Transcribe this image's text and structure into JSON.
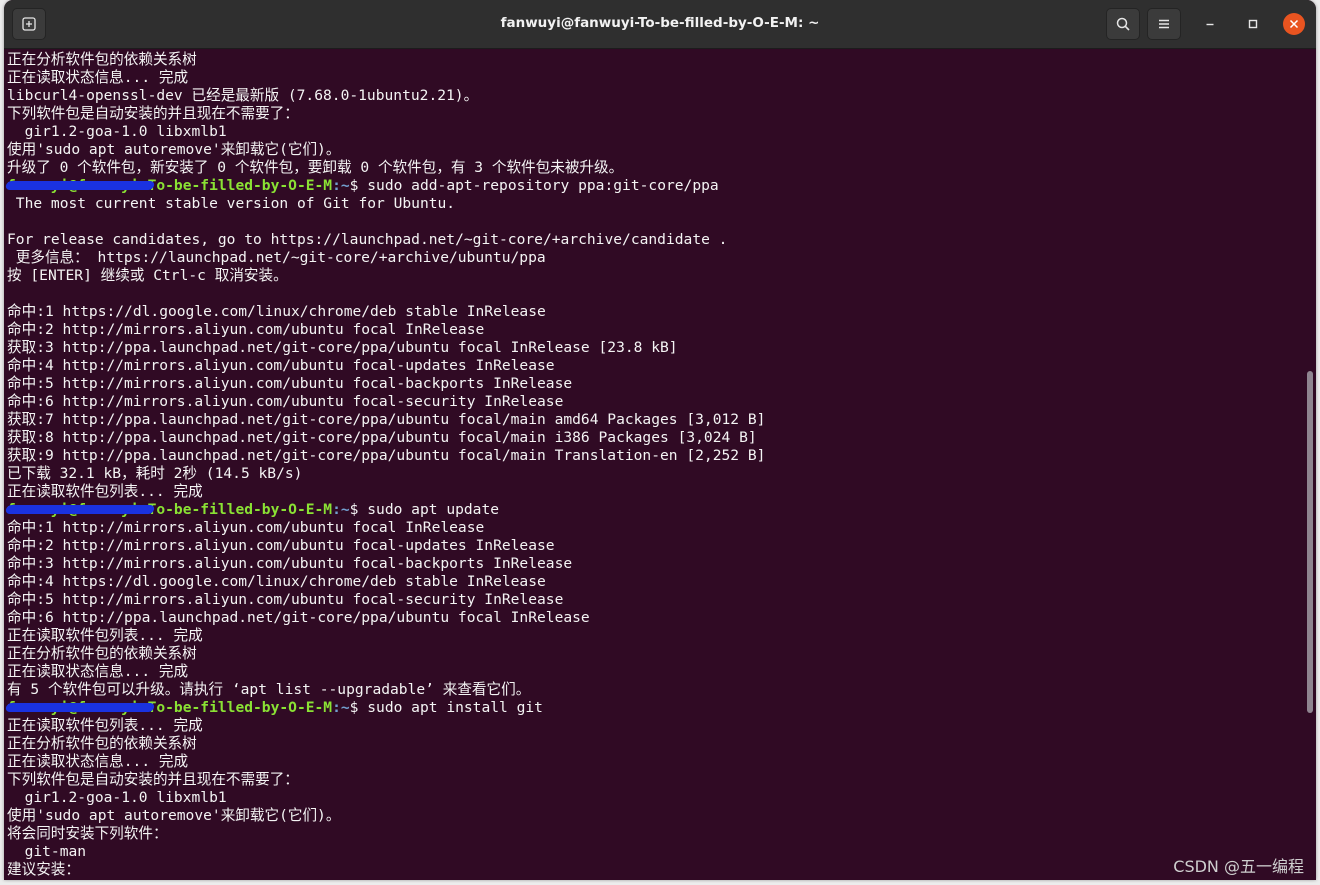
{
  "window": {
    "title": "fanwuyi@fanwuyi-To-be-filled-by-O-E-M: ~"
  },
  "icons": {
    "new_tab": "new-tab-icon",
    "search": "search-icon",
    "menu": "hamburger-menu-icon",
    "minimize": "minimize-icon",
    "maximize": "maximize-icon",
    "close": "close-icon"
  },
  "colors": {
    "terminal_bg": "#300a24",
    "prompt_user": "#8ae234",
    "prompt_path": "#729fcf",
    "close_button": "#e95420"
  },
  "terminal": {
    "lines": [
      {
        "text": "正在分析软件包的依赖关系树"
      },
      {
        "text": "正在读取状态信息... 完成"
      },
      {
        "text": "libcurl4-openssl-dev 已经是最新版 (7.68.0-1ubuntu2.21)。"
      },
      {
        "text": "下列软件包是自动安装的并且现在不需要了："
      },
      {
        "text": "  gir1.2-goa-1.0 libxmlb1"
      },
      {
        "text": "使用'sudo apt autoremove'来卸载它(它们)。"
      },
      {
        "text": "升级了 0 个软件包，新安装了 0 个软件包，要卸载 0 个软件包，有 3 个软件包未被升级。"
      },
      {
        "prompt_user": "fanwuyi@fanwuyi-To-be-filled-by-O-E-M",
        "prompt_path": ":~",
        "command": "$ sudo add-apt-repository ppa:git-core/ppa"
      },
      {
        "text": " The most current stable version of Git for Ubuntu."
      },
      {
        "text": ""
      },
      {
        "text": "For release candidates, go to https://launchpad.net/~git-core/+archive/candidate ."
      },
      {
        "text": " 更多信息： https://launchpad.net/~git-core/+archive/ubuntu/ppa"
      },
      {
        "text": "按 [ENTER] 继续或 Ctrl-c 取消安装。"
      },
      {
        "text": ""
      },
      {
        "text": "命中:1 https://dl.google.com/linux/chrome/deb stable InRelease"
      },
      {
        "text": "命中:2 http://mirrors.aliyun.com/ubuntu focal InRelease"
      },
      {
        "text": "获取:3 http://ppa.launchpad.net/git-core/ppa/ubuntu focal InRelease [23.8 kB]"
      },
      {
        "text": "命中:4 http://mirrors.aliyun.com/ubuntu focal-updates InRelease"
      },
      {
        "text": "命中:5 http://mirrors.aliyun.com/ubuntu focal-backports InRelease"
      },
      {
        "text": "命中:6 http://mirrors.aliyun.com/ubuntu focal-security InRelease"
      },
      {
        "text": "获取:7 http://ppa.launchpad.net/git-core/ppa/ubuntu focal/main amd64 Packages [3,012 B]"
      },
      {
        "text": "获取:8 http://ppa.launchpad.net/git-core/ppa/ubuntu focal/main i386 Packages [3,024 B]"
      },
      {
        "text": "获取:9 http://ppa.launchpad.net/git-core/ppa/ubuntu focal/main Translation-en [2,252 B]"
      },
      {
        "text": "已下载 32.1 kB，耗时 2秒 (14.5 kB/s)"
      },
      {
        "text": "正在读取软件包列表... 完成"
      },
      {
        "prompt_user": "fanwuyi@fanwuyi-To-be-filled-by-O-E-M",
        "prompt_path": ":~",
        "command": "$ sudo apt update"
      },
      {
        "text": "命中:1 http://mirrors.aliyun.com/ubuntu focal InRelease"
      },
      {
        "text": "命中:2 http://mirrors.aliyun.com/ubuntu focal-updates InRelease"
      },
      {
        "text": "命中:3 http://mirrors.aliyun.com/ubuntu focal-backports InRelease"
      },
      {
        "text": "命中:4 https://dl.google.com/linux/chrome/deb stable InRelease"
      },
      {
        "text": "命中:5 http://mirrors.aliyun.com/ubuntu focal-security InRelease"
      },
      {
        "text": "命中:6 http://ppa.launchpad.net/git-core/ppa/ubuntu focal InRelease"
      },
      {
        "text": "正在读取软件包列表... 完成"
      },
      {
        "text": "正在分析软件包的依赖关系树"
      },
      {
        "text": "正在读取状态信息... 完成"
      },
      {
        "text": "有 5 个软件包可以升级。请执行 ‘apt list --upgradable’ 来查看它们。"
      },
      {
        "prompt_user": "fanwuyi@fanwuyi-To-be-filled-by-O-E-M",
        "prompt_path": ":~",
        "command": "$ sudo apt install git"
      },
      {
        "text": "正在读取软件包列表... 完成"
      },
      {
        "text": "正在分析软件包的依赖关系树"
      },
      {
        "text": "正在读取状态信息... 完成"
      },
      {
        "text": "下列软件包是自动安装的并且现在不需要了："
      },
      {
        "text": "  gir1.2-goa-1.0 libxmlb1"
      },
      {
        "text": "使用'sudo apt autoremove'来卸载它(它们)。"
      },
      {
        "text": "将会同时安装下列软件："
      },
      {
        "text": "  git-man"
      },
      {
        "text": "建议安装："
      }
    ]
  },
  "watermark": "CSDN @五一编程"
}
